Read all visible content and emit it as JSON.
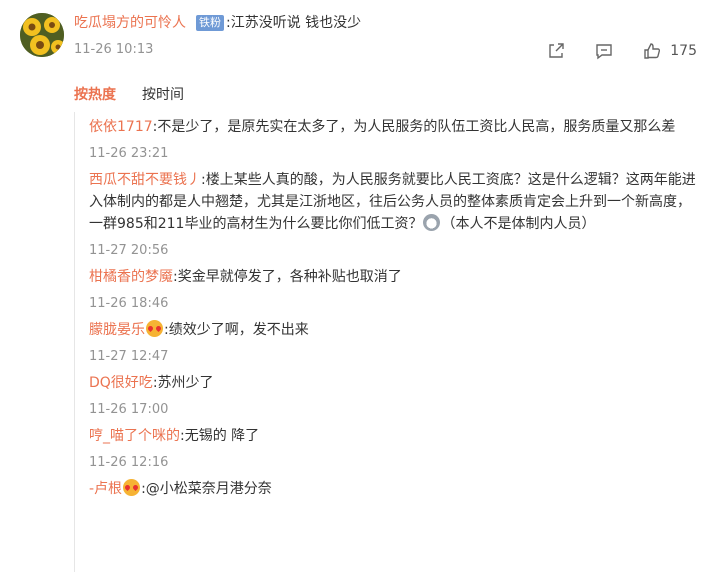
{
  "post": {
    "username": "吃瓜塌方的可怜人",
    "badge": "铁粉",
    "text": ":江苏没听说 钱也没少",
    "time": "11-26 10:13",
    "like_count": "175"
  },
  "tabs": {
    "hot": "按热度",
    "time": "按时间"
  },
  "replies": [
    {
      "user": "依依1717",
      "text": ":不是少了，是原先实在太多了，为人民服务的队伍工资比人民高，服务质量又那么差",
      "time": "11-26 23:21"
    },
    {
      "user": "西瓜不甜不要钱丿",
      "text": ":楼上某些人真的酸，为人民服务就要比人民工资底？这是什么逻辑？这两年能进入体制内的都是人中翘楚，尤其是江浙地区，往后公务人员的整体素质肯定会上升到一个新高度，一群985和211毕业的高材生为什么要比你们低工资？",
      "text_tail": "（本人不是体制内人员）",
      "time": "11-27 20:56"
    },
    {
      "user": "柑橘香的梦魇",
      "text": ":奖金早就停发了，各种补贴也取消了",
      "time": "11-26 18:46"
    },
    {
      "user": "朦胧晏乐",
      "text": ":绩效少了啊，发不出来",
      "time": "11-27 12:47"
    },
    {
      "user": "DQ很好吃",
      "text": ":苏州少了",
      "time": "11-26 17:00"
    },
    {
      "user": "哼_喵了个咪的",
      "text": ":无锡的 降了",
      "time": "11-26 12:16"
    },
    {
      "user": "-卢根",
      "text": ":@小松菜奈月港分奈"
    }
  ]
}
